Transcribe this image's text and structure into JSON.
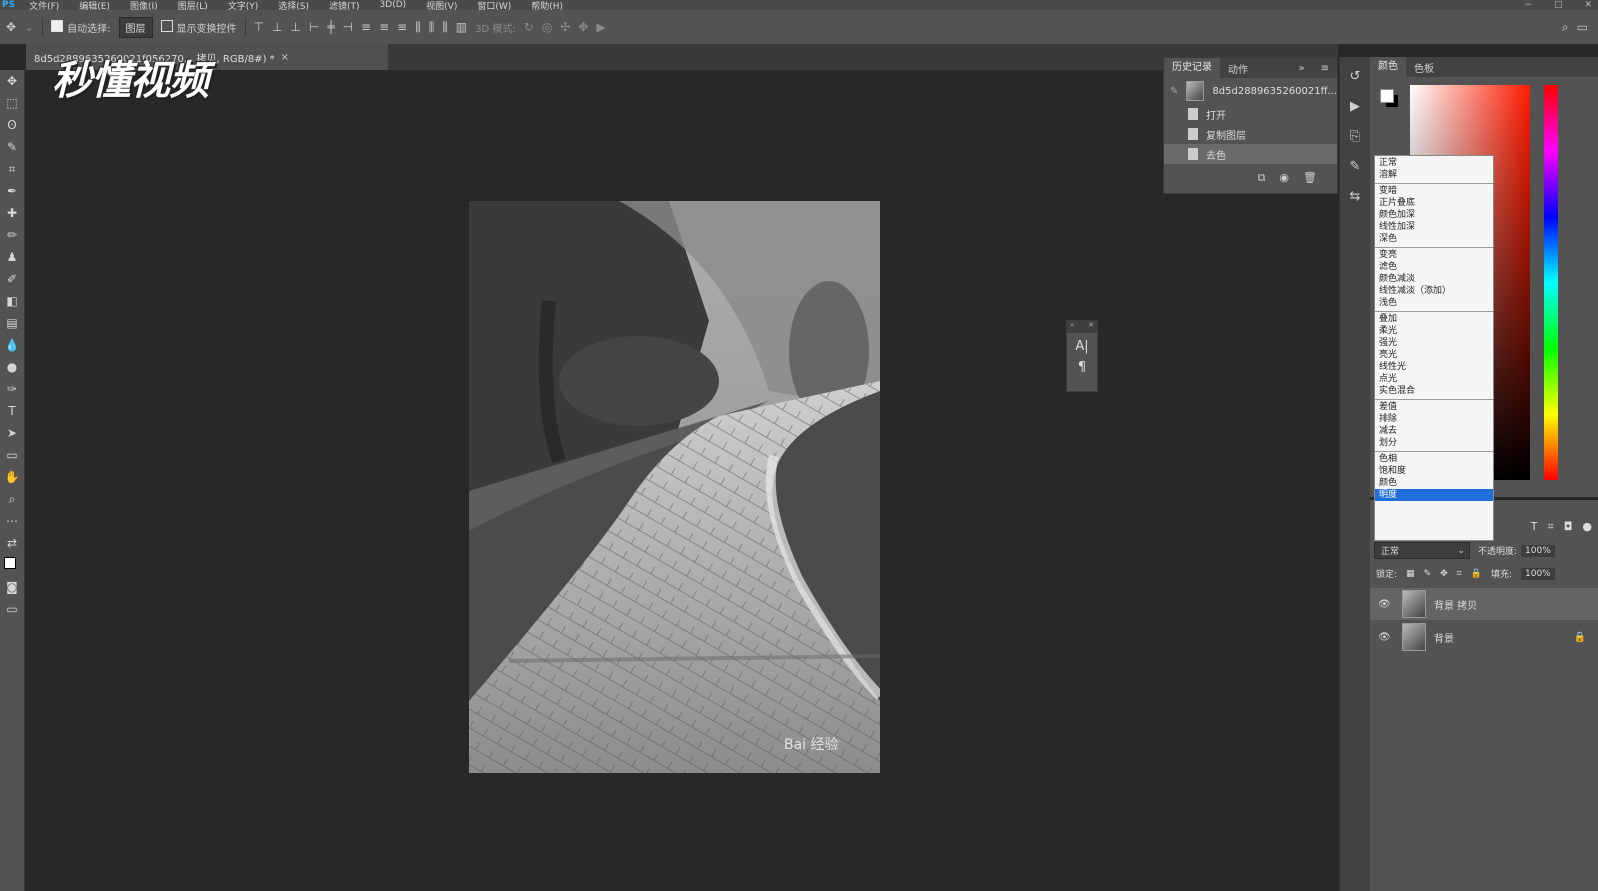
{
  "menubar": {
    "app": "PS",
    "items": [
      "文件(F)",
      "编辑(E)",
      "图像(I)",
      "图层(L)",
      "文字(Y)",
      "选择(S)",
      "滤镜(T)",
      "3D(D)",
      "视图(V)",
      "窗口(W)",
      "帮助(H)"
    ]
  },
  "options": {
    "auto_select_label": "自动选择:",
    "auto_select_value": "图层",
    "show_transform_label": "显示变换控件",
    "mode3d_label": "3D 模式:"
  },
  "document_tab": {
    "title": "8d5d2889635260021f056270... 拷贝, RGB/8#) *",
    "close": "×"
  },
  "watermark_logo": "秒懂视频",
  "history": {
    "tabs": [
      "历史记录",
      "动作"
    ],
    "snapshot": "8d5d2889635260021ff...",
    "steps": [
      "打开",
      "复制图层",
      "去色"
    ]
  },
  "color_panel": {
    "tabs": [
      "颜色",
      "色板"
    ]
  },
  "blend_menu": {
    "groups": [
      [
        "正常",
        "溶解"
      ],
      [
        "变暗",
        "正片叠底",
        "颜色加深",
        "线性加深",
        "深色"
      ],
      [
        "变亮",
        "滤色",
        "颜色减淡",
        "线性减淡（添加）",
        "浅色"
      ],
      [
        "叠加",
        "柔光",
        "强光",
        "亮光",
        "线性光",
        "点光",
        "实色混合"
      ],
      [
        "差值",
        "排除",
        "减去",
        "划分"
      ],
      [
        "色相",
        "饱和度",
        "颜色",
        "明度"
      ]
    ],
    "highlighted": "明度"
  },
  "layers_panel": {
    "blend_value": "正常",
    "opacity_label": "不透明度:",
    "opacity_value": "100%",
    "lock_label": "锁定:",
    "fill_label": "填充:",
    "fill_value": "100%",
    "layers": [
      {
        "name": "背景 拷贝",
        "selected": true
      },
      {
        "name": "背景",
        "selected": false
      }
    ]
  },
  "photo_watermark": "Bai 经验"
}
